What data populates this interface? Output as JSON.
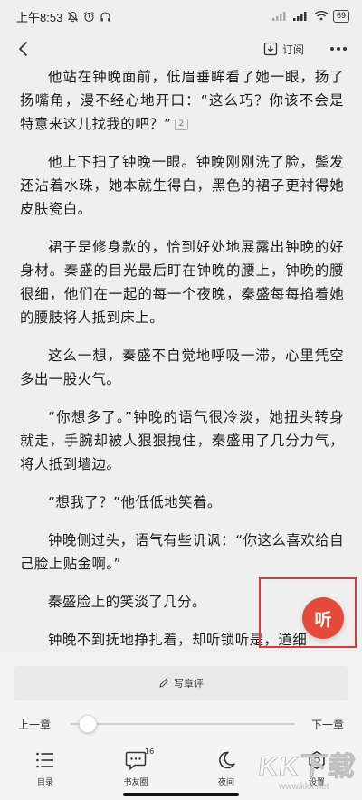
{
  "status_bar": {
    "time": "上午8:53",
    "battery": "69"
  },
  "nav": {
    "subscribe_label": "订阅"
  },
  "content": {
    "paragraphs": [
      "他站在钟晚面前，低眉垂眸看了她一眼，扬了扬嘴角，漫不经心地开口：“这么巧？你该不会是特意来这儿找我的吧？”",
      "他上下扫了钟晚一眼。钟晚刚刚洗了脸，鬓发还沾着水珠，她本就生得白，黑色的裙子更衬得她皮肤瓷白。",
      "裙子是修身款的，恰到好处地展露出钟晚的好身材。秦盛的目光最后盯在钟晚的腰上，钟晚的腰很细，他们在一起的每一个夜晚，秦盛每每掐着她的腰肢将人抵到床上。",
      "这么一想，秦盛不自觉地呼吸一滞，心里凭空多出一股火气。",
      "“你想多了。”钟晚的语气很冷淡，她扭头转身就走，手腕却被人狠狠拽住，秦盛用了几分力气，将人抵到墙边。",
      "“想我了？”他低低地笑着。",
      "钟晚侧过头，语气有些讥讽：“你这么喜欢给自己脸上贴金啊。”",
      "秦盛脸上的笑淡了几分。",
      "钟晚不到抚地挣扎着，却听锁听是，道细"
    ],
    "comment_count": "2"
  },
  "listen_button": {
    "label": "听"
  },
  "bottom": {
    "write_review_label": "写章评",
    "prev_chapter": "上一章",
    "next_chapter": "下一章",
    "progress": 0.02,
    "tabs": [
      {
        "label": "目录",
        "icon": "list-icon"
      },
      {
        "label": "书友圈",
        "icon": "chat-icon",
        "badge": "16"
      },
      {
        "label": "夜间",
        "icon": "moon-icon"
      },
      {
        "label": "设置",
        "icon": "gear-icon"
      }
    ]
  },
  "watermark": {
    "text": "KK下载",
    "url": "www.kkx.net"
  },
  "colors": {
    "background": "#efefef",
    "accent_red": "#e64a3b",
    "highlight_border": "#d63b3b"
  }
}
